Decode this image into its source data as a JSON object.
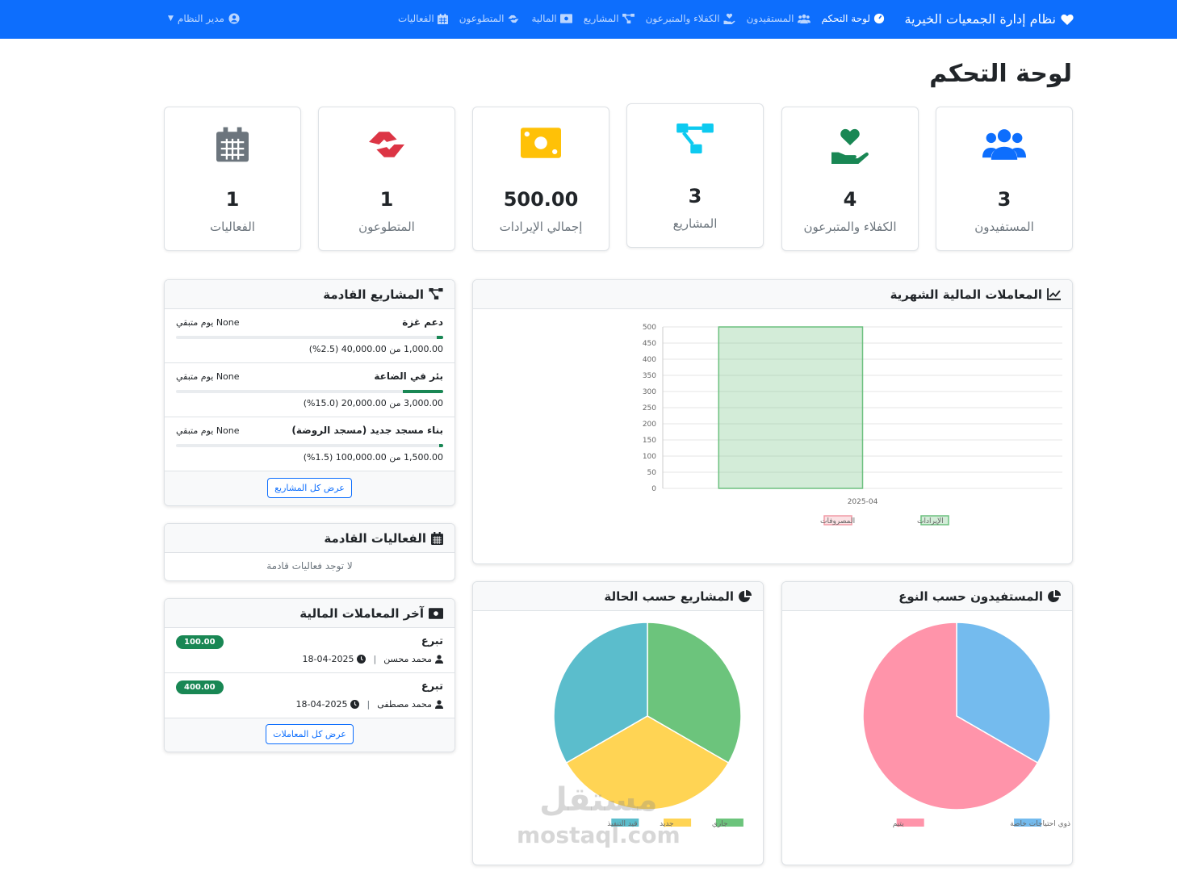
{
  "nav": {
    "brand": "نظام إدارة الجمعيات الخيرية",
    "links": [
      {
        "label": "لوحة التحكم",
        "icon": "dashboard-icon",
        "active": true
      },
      {
        "label": "المستفيدون",
        "icon": "users-icon"
      },
      {
        "label": "الكفلاء والمتبرعون",
        "icon": "hand-holding-heart-icon"
      },
      {
        "label": "المشاريع",
        "icon": "project-diagram-icon"
      },
      {
        "label": "المالية",
        "icon": "money-bill-icon"
      },
      {
        "label": "المتطوعون",
        "icon": "handshake-icon"
      },
      {
        "label": "الفعاليات",
        "icon": "calendar-icon"
      }
    ],
    "admin": "مدير النظام"
  },
  "page": {
    "title": "لوحة التحكم"
  },
  "stats": [
    {
      "value": "3",
      "label": "المستفيدون",
      "icon": "users-icon",
      "color": "#0d6efd"
    },
    {
      "value": "4",
      "label": "الكفلاء والمتبرعون",
      "icon": "hand-holding-heart-icon",
      "color": "#198754"
    },
    {
      "value": "3",
      "label": "المشاريع",
      "icon": "project-diagram-icon",
      "color": "#0dcaf0"
    },
    {
      "value": "500.00",
      "label": "إجمالي الإيرادات",
      "icon": "money-bill-icon",
      "color": "#ffc107"
    },
    {
      "value": "1",
      "label": "المتطوعون",
      "icon": "handshake-icon",
      "color": "#dc3545"
    },
    {
      "value": "1",
      "label": "الفعاليات",
      "icon": "calendar-icon",
      "color": "#6c757d"
    }
  ],
  "projects": {
    "title": "المشاريع القادمة",
    "items": [
      {
        "name": "دعم غزة",
        "days": "None يوم متبقي",
        "amount": "1,000.00 من 40,000.00 (2.5%)",
        "progress": 2.5
      },
      {
        "name": "بئر في الضاعة",
        "days": "None يوم متبقي",
        "amount": "3,000.00 من 20,000.00 (15.0%)",
        "progress": 15.0
      },
      {
        "name": "بناء مسجد جديد (مسجد الروضة)",
        "days": "None يوم متبقي",
        "amount": "1,500.00 من 100,000.00 (1.5%)",
        "progress": 1.5
      }
    ],
    "button": "عرض كل المشاريع"
  },
  "events": {
    "title": "الفعاليات القادمة",
    "empty": "لا توجد فعاليات قادمة"
  },
  "transactions": {
    "title": "آخر المعاملات المالية",
    "items": [
      {
        "type": "تبرع",
        "person": "محمد محسن",
        "date": "18-04-2025",
        "amount": "100.00"
      },
      {
        "type": "تبرع",
        "person": "محمد مصطفى",
        "date": "18-04-2025",
        "amount": "400.00"
      }
    ],
    "button": "عرض كل المعاملات"
  },
  "monthly_title": "المعاملات المالية الشهرية",
  "beneficiaries_title": "المستفيدون حسب النوع",
  "status_title": "المشاريع حسب الحالة",
  "watermark": {
    "line1": "مستقل",
    "line2": "mostaql.com"
  },
  "chart_data": [
    {
      "type": "bar",
      "title": "المعاملات المالية الشهرية",
      "categories": [
        "2025-04"
      ],
      "series": [
        {
          "name": "الإيرادات",
          "values": [
            500
          ],
          "color": "#6cc07f"
        },
        {
          "name": "المصروفات",
          "values": [
            0
          ],
          "color": "#f19aa5"
        }
      ],
      "ylim": [
        0,
        500
      ],
      "yticks": [
        0,
        50,
        100,
        150,
        200,
        250,
        300,
        350,
        400,
        450,
        500
      ],
      "grid": true,
      "legend": "bottom"
    },
    {
      "type": "pie",
      "title": "المستفيدون حسب النوع",
      "labels": [
        "ذوي احتياجات خاصة",
        "يتيم"
      ],
      "values": [
        1,
        2
      ],
      "colors": [
        "#74bbee",
        "#ff94aa"
      ],
      "legend": "bottom"
    },
    {
      "type": "pie",
      "title": "المشاريع حسب الحالة",
      "labels": [
        "جاري",
        "جديد",
        "قيد التنفيذ"
      ],
      "values": [
        1,
        1,
        1
      ],
      "colors": [
        "#6cc47c",
        "#ffd454",
        "#5bbdcc"
      ],
      "legend": "bottom"
    }
  ]
}
